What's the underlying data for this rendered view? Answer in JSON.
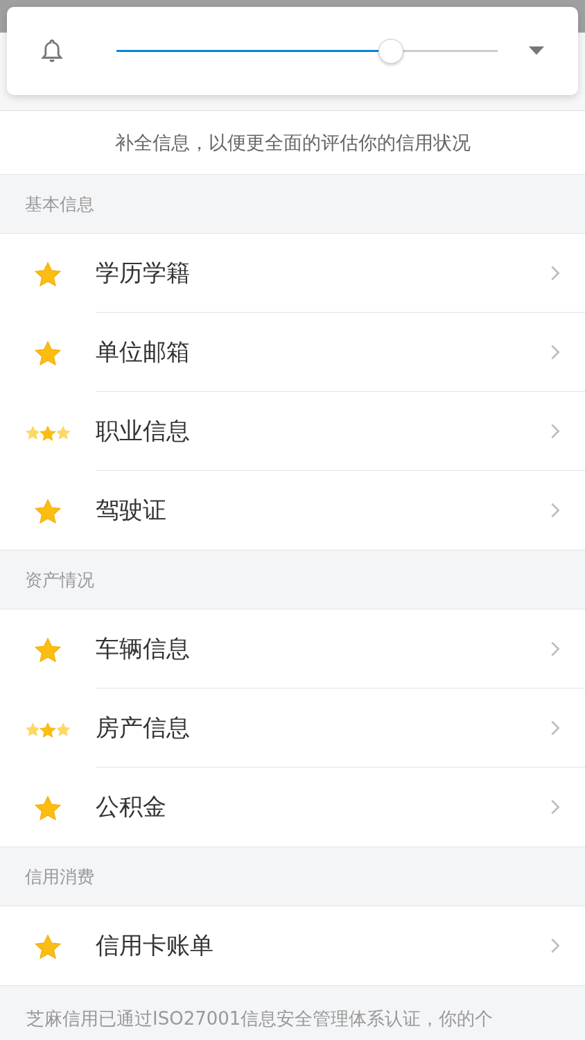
{
  "volume_panel": {
    "level": 0.72
  },
  "notice": "补全信息，以便更全面的评估你的信用状况",
  "sections": [
    {
      "title": "基本信息",
      "items": [
        {
          "label": "学历学籍",
          "kind": "single"
        },
        {
          "label": "单位邮箱",
          "kind": "single"
        },
        {
          "label": "职业信息",
          "kind": "triple"
        },
        {
          "label": "驾驶证",
          "kind": "single"
        }
      ]
    },
    {
      "title": "资产情况",
      "items": [
        {
          "label": "车辆信息",
          "kind": "single"
        },
        {
          "label": "房产信息",
          "kind": "triple"
        },
        {
          "label": "公积金",
          "kind": "single"
        }
      ]
    },
    {
      "title": "信用消费",
      "items": [
        {
          "label": "信用卡账单",
          "kind": "single"
        }
      ]
    }
  ],
  "footer": "芝麻信用已通过ISO27001信息安全管理体系认证，你的个"
}
